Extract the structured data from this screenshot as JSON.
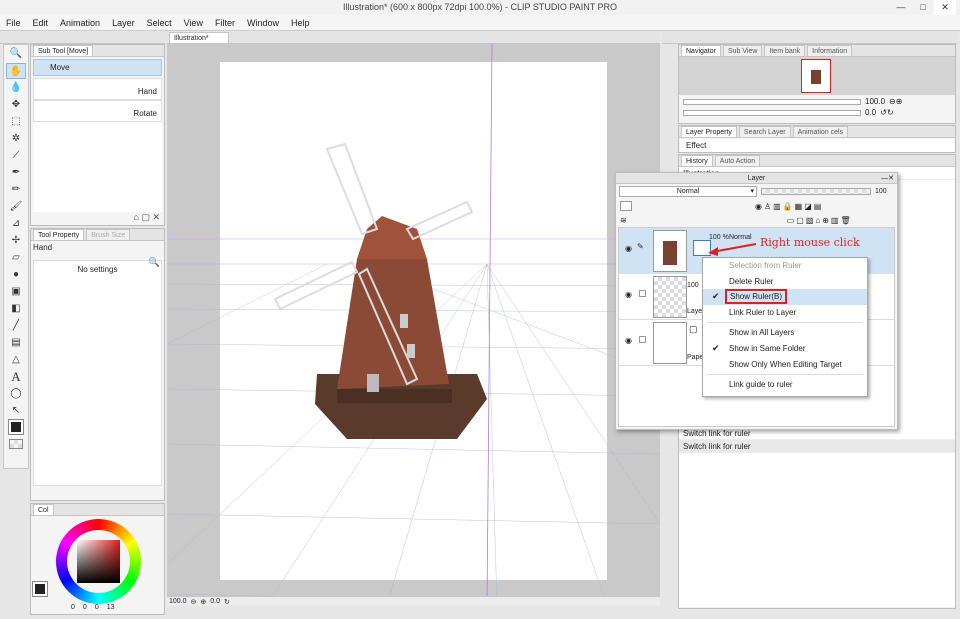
{
  "window": {
    "title": "Illustration* (600 x 800px 72dpi 100.0%) - CLIP STUDIO PAINT PRO",
    "min": "—",
    "max": "□",
    "close": "✕"
  },
  "menu": [
    "File",
    "Edit",
    "Animation",
    "Layer",
    "Select",
    "View",
    "Filter",
    "Window",
    "Help"
  ],
  "subtool": {
    "tab": "Sub Tool [Move]",
    "items": [
      {
        "label": "Move"
      },
      {
        "label": "Hand"
      },
      {
        "label": "Rotate"
      }
    ]
  },
  "tool_property": {
    "tab": "Tool Property",
    "tab2": "Brush Size",
    "name": "Hand",
    "empty": "No settings"
  },
  "color": {
    "tab": "Col",
    "values": [
      "0",
      "0",
      "0",
      "13"
    ]
  },
  "canvas": {
    "tab": "Illustration*",
    "zoom": "100.0",
    "angle": "0.0"
  },
  "navigator": {
    "tabs": [
      "Navigator",
      "Sub View",
      "Item bank",
      "Information"
    ],
    "zoom": "100.0",
    "angle": "0.0"
  },
  "layer_property": {
    "tabs": [
      "Layer Property",
      "Search Layer",
      "Animation cels"
    ],
    "effect": "Effect"
  },
  "history": {
    "tabs": [
      "History",
      "Auto Action"
    ],
    "items": [
      "Illustration",
      "Switch link for ruler",
      "Switch link for ruler"
    ]
  },
  "layer_panel": {
    "title": "Layer",
    "blend": "Normal",
    "opacity": "100",
    "layers": [
      {
        "opacity": "100 %",
        "blend": "Normal",
        "name": ""
      },
      {
        "opacity": "100",
        "blend": "",
        "name": "Layer"
      },
      {
        "opacity": "",
        "blend": "",
        "name": "Paper"
      }
    ]
  },
  "annotation": "Right mouse click",
  "context_menu": {
    "items": [
      {
        "label": "Selection from Ruler",
        "disabled": true,
        "checked": false
      },
      {
        "label": "Delete Ruler",
        "disabled": false,
        "checked": false
      },
      {
        "label": "Show Ruler(B)",
        "disabled": false,
        "checked": true
      },
      {
        "label": "Link Ruler to Layer",
        "disabled": false,
        "checked": false
      },
      {
        "label": "Show in All Layers",
        "disabled": false,
        "checked": false
      },
      {
        "label": "Show in Same Folder",
        "disabled": false,
        "checked": true
      },
      {
        "label": "Show Only When Editing Target",
        "disabled": false,
        "checked": false
      },
      {
        "label": "Link guide to ruler",
        "disabled": false,
        "checked": false
      }
    ]
  },
  "colors": {
    "accent": "#e02020",
    "highlight": "#cfe3f5"
  }
}
